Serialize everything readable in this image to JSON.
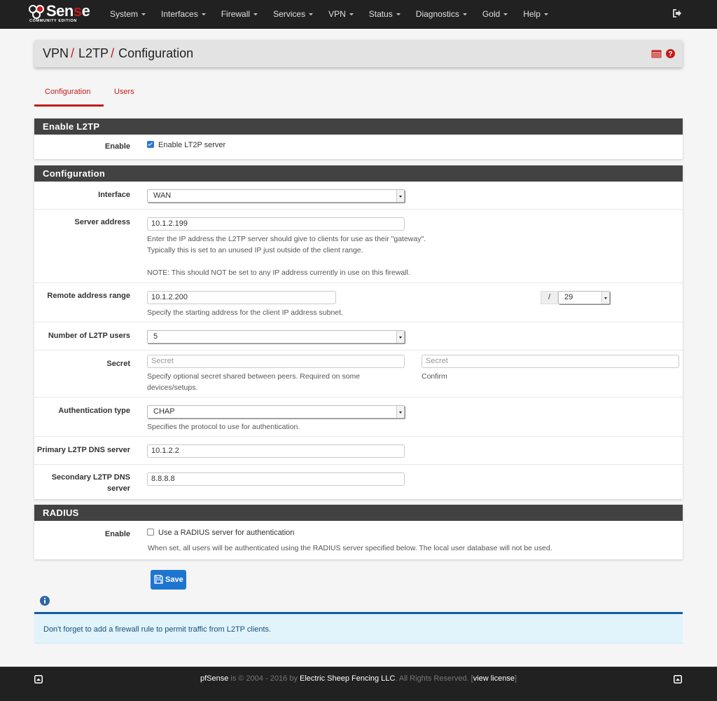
{
  "navbar": {
    "logo": {
      "brand_pre": "Sen",
      "brand_red": "s",
      "brand_post": "e",
      "edition": "COMMUNITY EDITION"
    },
    "items": [
      {
        "label": "System"
      },
      {
        "label": "Interfaces"
      },
      {
        "label": "Firewall"
      },
      {
        "label": "Services"
      },
      {
        "label": "VPN"
      },
      {
        "label": "Status"
      },
      {
        "label": "Diagnostics"
      },
      {
        "label": "Gold"
      },
      {
        "label": "Help"
      }
    ],
    "logout_icon": "sign-out-icon"
  },
  "header": {
    "breadcrumb": [
      "VPN",
      "L2TP",
      "Configuration"
    ],
    "separator": "/",
    "icons": [
      "log-list-icon",
      "help-question-icon"
    ]
  },
  "tabs": [
    {
      "label": "Configuration",
      "active": true
    },
    {
      "label": "Users",
      "active": false
    }
  ],
  "enable_section": {
    "title": "Enable L2TP",
    "enable_label": "Enable",
    "checkbox_label": "Enable LT2P server",
    "checked": true
  },
  "config_section": {
    "title": "Configuration",
    "interface": {
      "label": "Interface",
      "value": "WAN"
    },
    "server_address": {
      "label": "Server address",
      "value": "10.1.2.199",
      "help_1": "Enter the IP address the L2TP server should give to clients for use as their \"gateway\".",
      "help_2": "Typically this is set to an unused IP just outside of the client range.",
      "help_3": "NOTE: This should NOT be set to any IP address currently in use on this firewall."
    },
    "remote_range": {
      "label": "Remote address range",
      "value": "10.1.2.200",
      "help": "Specify the starting address for the client IP address subnet.",
      "slash": "/",
      "mask": "29"
    },
    "num_users": {
      "label": "Number of L2TP users",
      "value": "5"
    },
    "secret": {
      "label": "Secret",
      "placeholder": "Secret",
      "help_1": "Specify optional secret shared between peers. Required on some",
      "help_2": "devices/setups.",
      "confirm_placeholder": "Secret",
      "confirm_label": "Confirm"
    },
    "auth_type": {
      "label": "Authentication type",
      "value": "CHAP",
      "help": "Specifies the protocol to use for authentication."
    },
    "dns_primary": {
      "label": "Primary L2TP DNS server",
      "value": "10.1.2.2"
    },
    "dns_secondary": {
      "label_1": "Secondary L2TP DNS",
      "label_2": "server",
      "value": "8.8.8.8"
    }
  },
  "radius_section": {
    "title": "RADIUS",
    "enable_label": "Enable",
    "checkbox_label": "Use a RADIUS server for authentication",
    "checked": false,
    "help": "When set, all users will be authenticated using the RADIUS server specified below. The local user database will not be used."
  },
  "save_button": {
    "label": "Save"
  },
  "info_alert": {
    "text": "Don't forget to add a firewall rule to permit traffic from L2TP clients."
  },
  "footer": {
    "brand": "pfSense",
    "text_1": " is © 2004 - 2016 by ",
    "company": "Electric Sheep Fencing LLC",
    "text_2": ". All Rights Reserved. [",
    "license_link": "view license",
    "text_3": "]"
  },
  "colors": {
    "accent_red": "#c41b1b",
    "navbar_bg": "#212121",
    "panel_heading_bg": "#424242",
    "primary_blue": "#1e75d0",
    "info_bg": "#e1f3fb",
    "info_border": "#0d5fa5"
  }
}
